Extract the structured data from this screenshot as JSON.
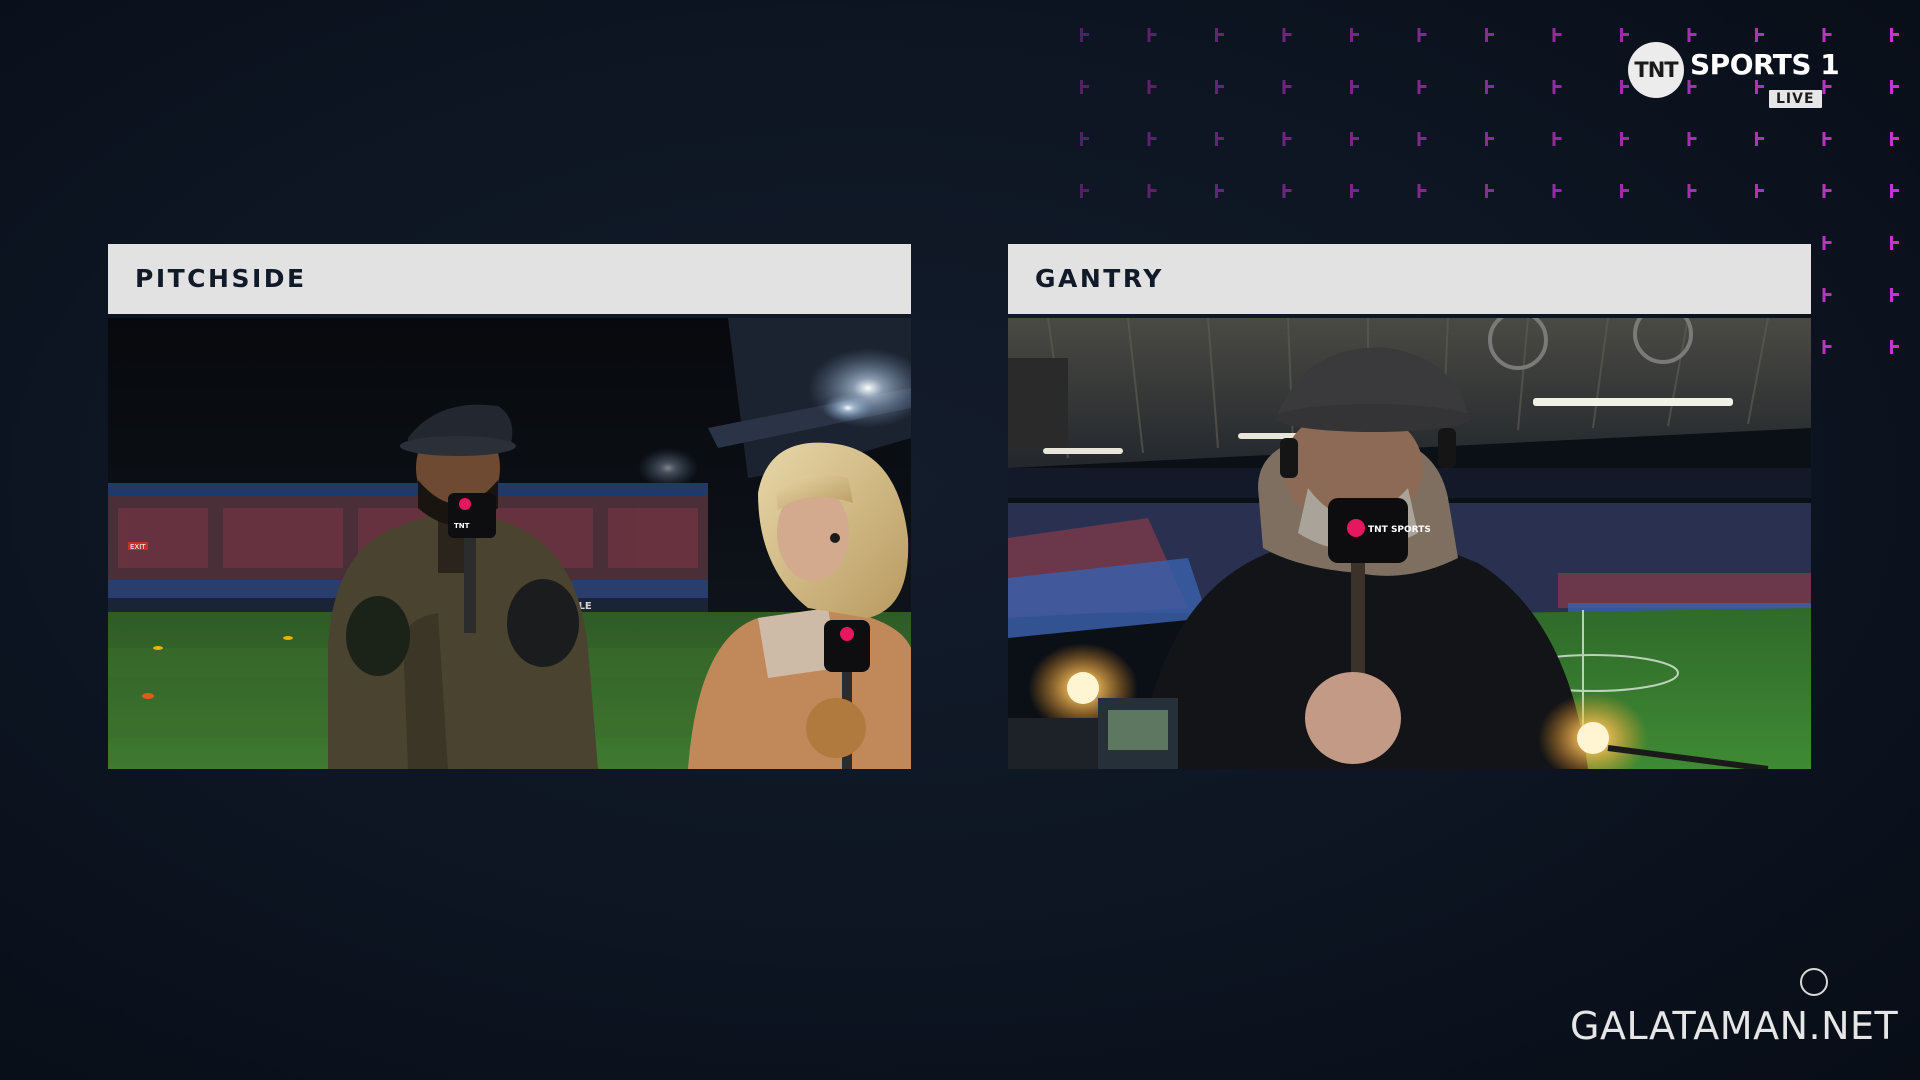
{
  "broadcast": {
    "channel": {
      "logo_mark": "TNT",
      "name": "SPORTS 1",
      "status_badge": "LIVE"
    },
    "accent_color": "#d036d8",
    "background_color": "#0d1522"
  },
  "panels": [
    {
      "title": "PITCHSIDE",
      "feed": {
        "mic_flag_text": "TNT",
        "ad_board_text": "THE SALE",
        "sign_text": "EXIT"
      }
    },
    {
      "title": "GANTRY",
      "feed": {
        "mic_flag_text": "TNT SPORTS"
      }
    }
  ],
  "watermark": {
    "text": "GALATAMAN.NET",
    "icon": "circle-icon"
  }
}
